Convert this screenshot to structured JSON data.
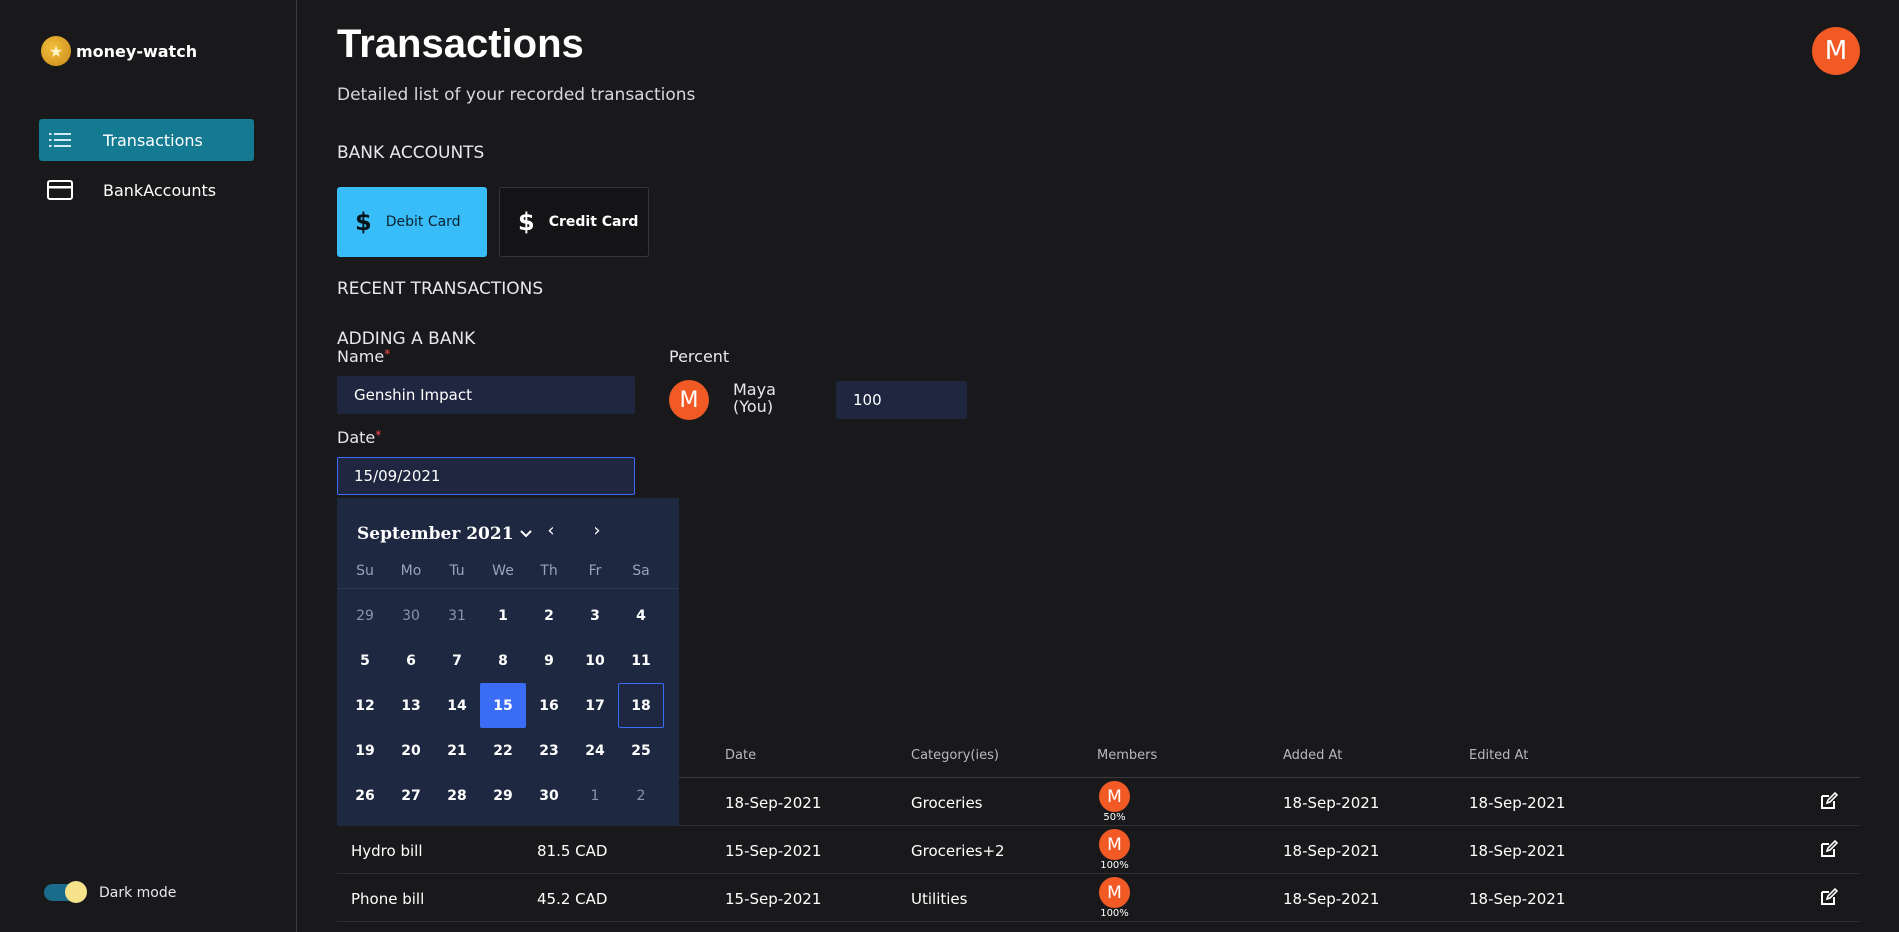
{
  "brand": {
    "name": "money-watch",
    "logo_icon": "star-coin-icon"
  },
  "sidebar": {
    "items": [
      {
        "label": "Transactions",
        "icon": "list-icon",
        "active": true
      },
      {
        "label": "BankAccounts",
        "icon": "card-icon",
        "active": false
      }
    ],
    "dark_mode": {
      "label": "Dark mode",
      "on": true
    }
  },
  "header": {
    "title": "Transactions",
    "subtitle": "Detailed list of your recorded transactions",
    "avatar_initial": "M"
  },
  "bank_accounts": {
    "title": "BANK ACCOUNTS",
    "cards": [
      {
        "label": "Debit Card",
        "icon": "dollar-icon",
        "selected": true
      },
      {
        "label": "Credit Card",
        "icon": "dollar-icon",
        "selected": false
      }
    ]
  },
  "recent_title": "RECENT TRANSACTIONS",
  "form": {
    "title": "ADDING A BANK",
    "name_label": "Name",
    "name_value": "Genshin Impact",
    "date_label": "Date",
    "date_value": "15/09/2021",
    "required_mark": "*",
    "percent_label": "Percent",
    "member": {
      "initial": "M",
      "name_line1": "Maya",
      "name_line2": "(You)",
      "percent": "100"
    }
  },
  "calendar": {
    "month_label": "September 2021",
    "prev": "‹",
    "next": "›",
    "weekdays": [
      "Su",
      "Mo",
      "Tu",
      "We",
      "Th",
      "Fr",
      "Sa"
    ],
    "days": [
      {
        "d": "29",
        "muted": true
      },
      {
        "d": "30",
        "muted": true
      },
      {
        "d": "31",
        "muted": true
      },
      {
        "d": "1"
      },
      {
        "d": "2"
      },
      {
        "d": "3"
      },
      {
        "d": "4"
      },
      {
        "d": "5"
      },
      {
        "d": "6"
      },
      {
        "d": "7"
      },
      {
        "d": "8"
      },
      {
        "d": "9"
      },
      {
        "d": "10"
      },
      {
        "d": "11"
      },
      {
        "d": "12"
      },
      {
        "d": "13"
      },
      {
        "d": "14"
      },
      {
        "d": "15",
        "selected": true
      },
      {
        "d": "16"
      },
      {
        "d": "17"
      },
      {
        "d": "18",
        "today": true
      },
      {
        "d": "19"
      },
      {
        "d": "20"
      },
      {
        "d": "21"
      },
      {
        "d": "22"
      },
      {
        "d": "23"
      },
      {
        "d": "24"
      },
      {
        "d": "25"
      },
      {
        "d": "26"
      },
      {
        "d": "27"
      },
      {
        "d": "28"
      },
      {
        "d": "29"
      },
      {
        "d": "30"
      },
      {
        "d": "1",
        "muted": true
      },
      {
        "d": "2",
        "muted": true
      }
    ]
  },
  "table": {
    "headers": [
      "Date",
      "Category(ies)",
      "Members",
      "Added At",
      "Edited At"
    ],
    "rows": [
      {
        "name": "",
        "amount": "",
        "date": "18-Sep-2021",
        "category": "Groceries",
        "member_initial": "M",
        "member_pct": "50%",
        "added": "18-Sep-2021",
        "edited": "18-Sep-2021"
      },
      {
        "name": "Hydro bill",
        "amount": "81.5 CAD",
        "date": "15-Sep-2021",
        "category": "Groceries+2",
        "member_initial": "M",
        "member_pct": "100%",
        "added": "18-Sep-2021",
        "edited": "18-Sep-2021"
      },
      {
        "name": "Phone bill",
        "amount": "45.2 CAD",
        "date": "15-Sep-2021",
        "category": "Utilities",
        "member_initial": "M",
        "member_pct": "100%",
        "added": "18-Sep-2021",
        "edited": "18-Sep-2021"
      }
    ]
  },
  "colors": {
    "accent": "#137a92",
    "debit_card": "#38bdf8",
    "avatar": "#f15a24",
    "calendar_bg": "#1e2840",
    "selected_day": "#3b6cf6"
  }
}
